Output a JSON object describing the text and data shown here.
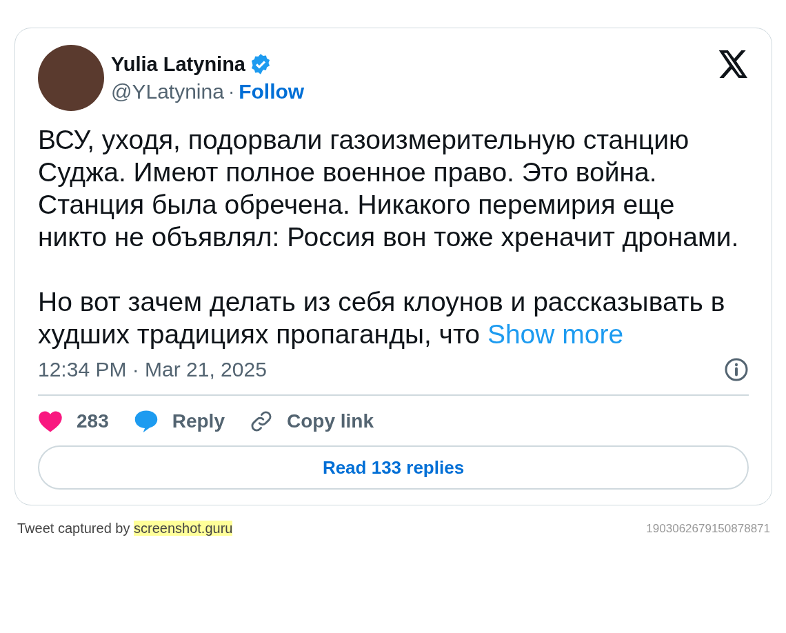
{
  "author": {
    "name": "Yulia Latynina",
    "verified": true,
    "handle": "@YLatynina",
    "separator": "·",
    "follow": "Follow"
  },
  "text": {
    "paragraphs": [
      "ВСУ, уходя, подорвали газоизмерительную станцию Суджа. Имеют полное военное право. Это война. Станция была обречена. Никакого перемирия еще никто не объявлял: Россия вон тоже хреначит дронами.",
      "Но вот зачем делать из себя клоунов и рассказывать в худших традициях пропаганды, что"
    ],
    "show_more": "Show more"
  },
  "timestamp": "12:34 PM · Mar 21, 2025",
  "actions": [
    {
      "kind": "like",
      "label": "283"
    },
    {
      "kind": "reply",
      "label": "Reply"
    },
    {
      "kind": "copy",
      "label": "Copy link"
    }
  ],
  "read_replies": "Read 133 replies",
  "footer": {
    "caption": "Tweet captured by",
    "site": "screenshot.guru",
    "tweet_id": "1903062679150878871"
  }
}
